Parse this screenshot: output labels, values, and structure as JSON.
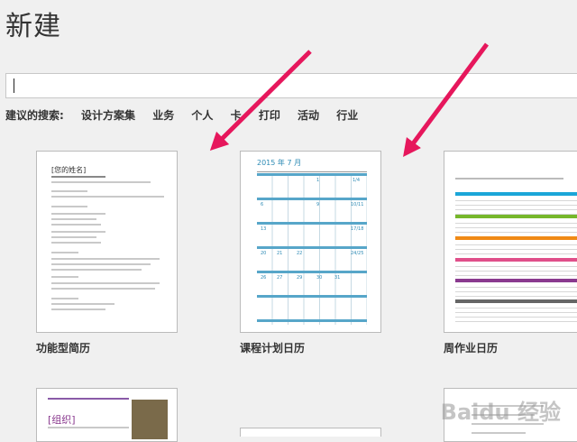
{
  "page_title": "新建",
  "search": {
    "value": "",
    "placeholder": ""
  },
  "suggestions": {
    "label": "建议的搜索:",
    "items": [
      "设计方案集",
      "业务",
      "个人",
      "卡",
      "打印",
      "活动",
      "行业"
    ]
  },
  "templates": [
    {
      "label": "功能型简历",
      "thumb_title": "[您的姓名]"
    },
    {
      "label": "课程计划日历",
      "thumb_title": "2015 年 7 月"
    },
    {
      "label": "周作业日历",
      "thumb_title": ""
    },
    {
      "label": "",
      "thumb_title": "[组织]"
    },
    {
      "label": "",
      "thumb_title": ""
    }
  ],
  "calendar_numbers": [
    "1",
    "1/4",
    "6",
    "9",
    "10/11",
    "13",
    "17/18",
    "20",
    "21",
    "22",
    "24/25",
    "26",
    "27",
    "29",
    "30",
    "31"
  ],
  "colors": {
    "accent": "#2e8bb5",
    "arrow": "#e6175c",
    "band1": "#1ba6d8",
    "band2": "#76b72a",
    "band3": "#f08a16",
    "band4": "#e04f8a",
    "band5": "#8a3a8f",
    "band6": "#666666"
  },
  "watermark": "Baidu 经验"
}
